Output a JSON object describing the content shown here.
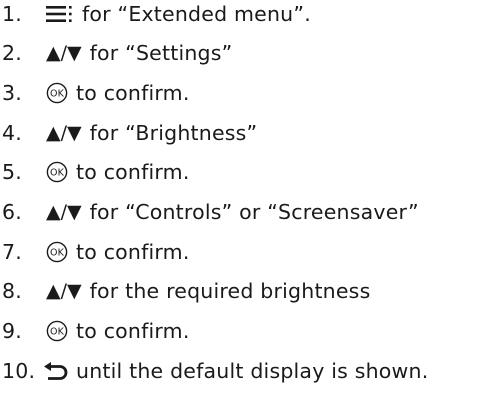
{
  "steps": [
    {
      "number": "1.",
      "icon": "menu-icon",
      "text": "for “Extended menu”."
    },
    {
      "number": "2.",
      "icon": "up-down-arrows",
      "arrows": "▲/▼",
      "text": "for “Settings”"
    },
    {
      "number": "3.",
      "icon": "ok-button-icon",
      "text": "to confirm."
    },
    {
      "number": "4.",
      "icon": "up-down-arrows",
      "arrows": "▲/▼",
      "text": "for “Brightness”"
    },
    {
      "number": "5.",
      "icon": "ok-button-icon",
      "text": "to confirm."
    },
    {
      "number": "6.",
      "icon": "up-down-arrows",
      "arrows": "▲/▼",
      "text": "for “Controls” or “Screensaver”"
    },
    {
      "number": "7.",
      "icon": "ok-button-icon",
      "text": "to confirm."
    },
    {
      "number": "8.",
      "icon": "up-down-arrows",
      "arrows": "▲/▼",
      "text": "for the required brightness"
    },
    {
      "number": "9.",
      "icon": "ok-button-icon",
      "text": "to confirm."
    },
    {
      "number": "10.",
      "icon": "back-arrow-icon",
      "text": "until the default display is shown."
    }
  ]
}
